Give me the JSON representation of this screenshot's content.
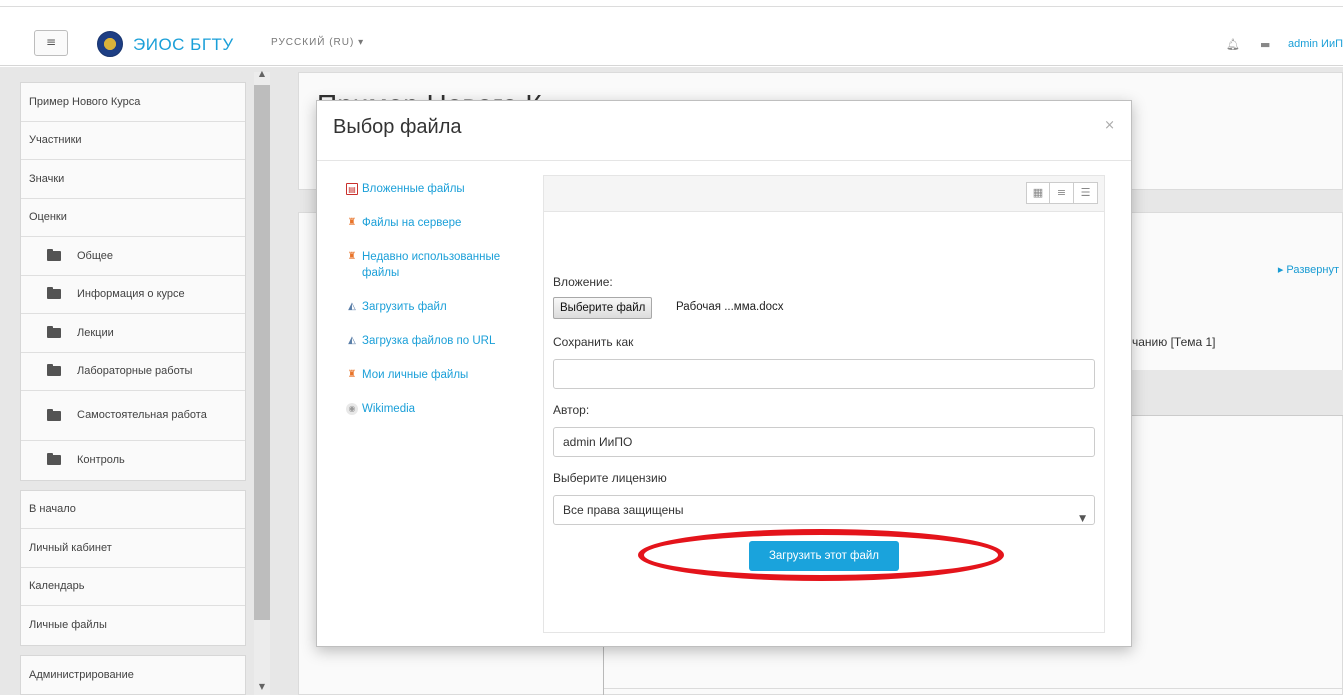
{
  "navbar": {
    "menu_icon": "hamburger-icon",
    "site_name": "ЭИОС БГТУ",
    "language": "РУССКИЙ (RU) ▾",
    "username": "admin ИиП"
  },
  "sidebar": {
    "course_block": [
      {
        "label": "Пример Нового Курса",
        "folder": false
      },
      {
        "label": "Участники",
        "folder": false
      },
      {
        "label": "Значки",
        "folder": false
      },
      {
        "label": "Оценки",
        "folder": false
      },
      {
        "label": "Общее",
        "folder": true
      },
      {
        "label": "Информация о курсе",
        "folder": true
      },
      {
        "label": "Лекции",
        "folder": true
      },
      {
        "label": "Лабораторные работы",
        "folder": true
      },
      {
        "label": "Самостоятельная работа",
        "folder": true
      },
      {
        "label": "Контроль",
        "folder": true
      }
    ],
    "nav_block": [
      "В начало",
      "Личный кабинет",
      "Календарь",
      "Личные файлы"
    ],
    "admin_block": [
      "Администрирование"
    ]
  },
  "background": {
    "course_title": "Пример Нового К",
    "expand_label": "▸ Развернут",
    "topic_text": "чанию [Тема 1]"
  },
  "modal": {
    "title": "Выбор файла",
    "close": "×",
    "repositories": [
      {
        "label": "Вложенные файлы",
        "icon": "file-icon"
      },
      {
        "label": "Файлы на сервере",
        "icon": "server-icon"
      },
      {
        "label": "Недавно использованные файлы",
        "icon": "recent-icon"
      },
      {
        "label": "Загрузить файл",
        "icon": "upload-icon"
      },
      {
        "label": "Загрузка файлов по URL",
        "icon": "url-upload-icon"
      },
      {
        "label": "Мои личные файлы",
        "icon": "private-files-icon"
      },
      {
        "label": "Wikimedia",
        "icon": "wikimedia-icon"
      }
    ],
    "form": {
      "attachment_label": "Вложение:",
      "choose_file_label": "Выберите файл",
      "chosen_file": "Рабочая ...мма.docx",
      "save_as_label": "Сохранить как",
      "save_as_value": "",
      "author_label": "Автор:",
      "author_value": "admin ИиПО",
      "license_label": "Выберите лицензию",
      "license_value": "Все права защищены",
      "upload_button": "Загрузить этот файл"
    }
  },
  "annotation": {
    "highlight_color": "#e4141b"
  }
}
